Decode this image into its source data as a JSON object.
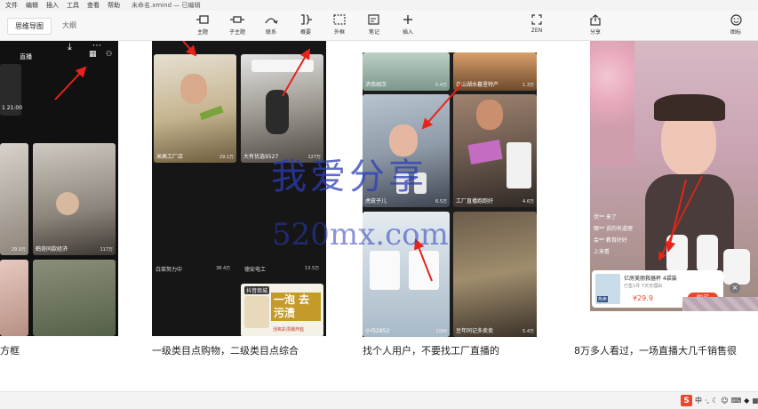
{
  "menubar": {
    "items": [
      "文件",
      "编辑",
      "插入",
      "工具",
      "查看",
      "帮助"
    ],
    "doc_title": "未命名.xmind — 已编辑"
  },
  "toolbar": {
    "tabs": [
      {
        "label": "思维导图",
        "active": true
      },
      {
        "label": "大纲",
        "active": false
      }
    ],
    "buttons": [
      {
        "label": "主题",
        "icon": "topic-icon"
      },
      {
        "label": "子主题",
        "icon": "subtopic-icon"
      },
      {
        "label": "联系",
        "icon": "relationship-icon"
      },
      {
        "label": "概要",
        "icon": "summary-icon"
      },
      {
        "label": "外框",
        "icon": "boundary-icon"
      },
      {
        "label": "笔记",
        "icon": "note-icon"
      },
      {
        "label": "插入",
        "icon": "plus-icon"
      },
      {
        "label": "ZEN",
        "icon": "zen-icon"
      },
      {
        "label": "分享",
        "icon": "share-icon"
      },
      {
        "label": "图标",
        "icon": "emoji-icon"
      }
    ]
  },
  "captions": [
    "方框",
    "一级类目点购物，二级类目点综合",
    "找个人用户，不要找工厂直播的",
    "8万多人看过，一场直播大几千销售很"
  ],
  "panel1": {
    "header": "直播",
    "timestamp": "1 21:00",
    "cards": [
      {
        "label": "",
        "count": "29.9万"
      },
      {
        "label": "鹤奇同款经济",
        "count": "117万"
      },
      {
        "label": "",
        "count": ""
      },
      {
        "label": "",
        "count": ""
      }
    ]
  },
  "panel2": {
    "cards": [
      {
        "label": "米高工厂店",
        "count": "29.1万"
      },
      {
        "label": "大有优选9527",
        "count": "127万"
      },
      {
        "label": "白菜努力中",
        "count": "38.4万"
      },
      {
        "label": "德安电工",
        "count": "13.5万"
      },
      {
        "label": "抖音商城",
        "count": ""
      }
    ],
    "ad_text": "一泡 去污渍",
    "ad_sub": "活氧彩漂爆炸盐"
  },
  "panel3": {
    "cards": [
      {
        "label": "济南胡次",
        "count": "5.4万"
      },
      {
        "label": "白山湖水暮里特产",
        "count": "1.3万"
      },
      {
        "label": "虎皮子儿",
        "count": "6.5万"
      },
      {
        "label": "工厂直播跑跑好",
        "count": "4.6万"
      },
      {
        "label": "小马2852",
        "count": "2099"
      },
      {
        "label": "豆年同记多卖卖",
        "count": "5.4万"
      }
    ]
  },
  "panel4": {
    "chat_lines": [
      "伏** 来了",
      "哪** 说的有道理",
      "会** 教育好好",
      "上来看"
    ],
    "product_title": "亿房美丽救器杯 4袋装",
    "product_sub": "已售1件 7天无理由",
    "product_price": "¥29.9",
    "buy_label": "购买",
    "product_tag": "热卖"
  },
  "watermark": {
    "cn": "我爱分享",
    "en": "520mx.com"
  },
  "statusbar": {
    "ime_char": "中"
  },
  "colors": {
    "arrow": "#e8231b",
    "toolbar_bg": "#f7f7f7",
    "canvas_bg": "#ffffff",
    "watermark": "#2b3db8",
    "accent_red": "#e8472c"
  }
}
